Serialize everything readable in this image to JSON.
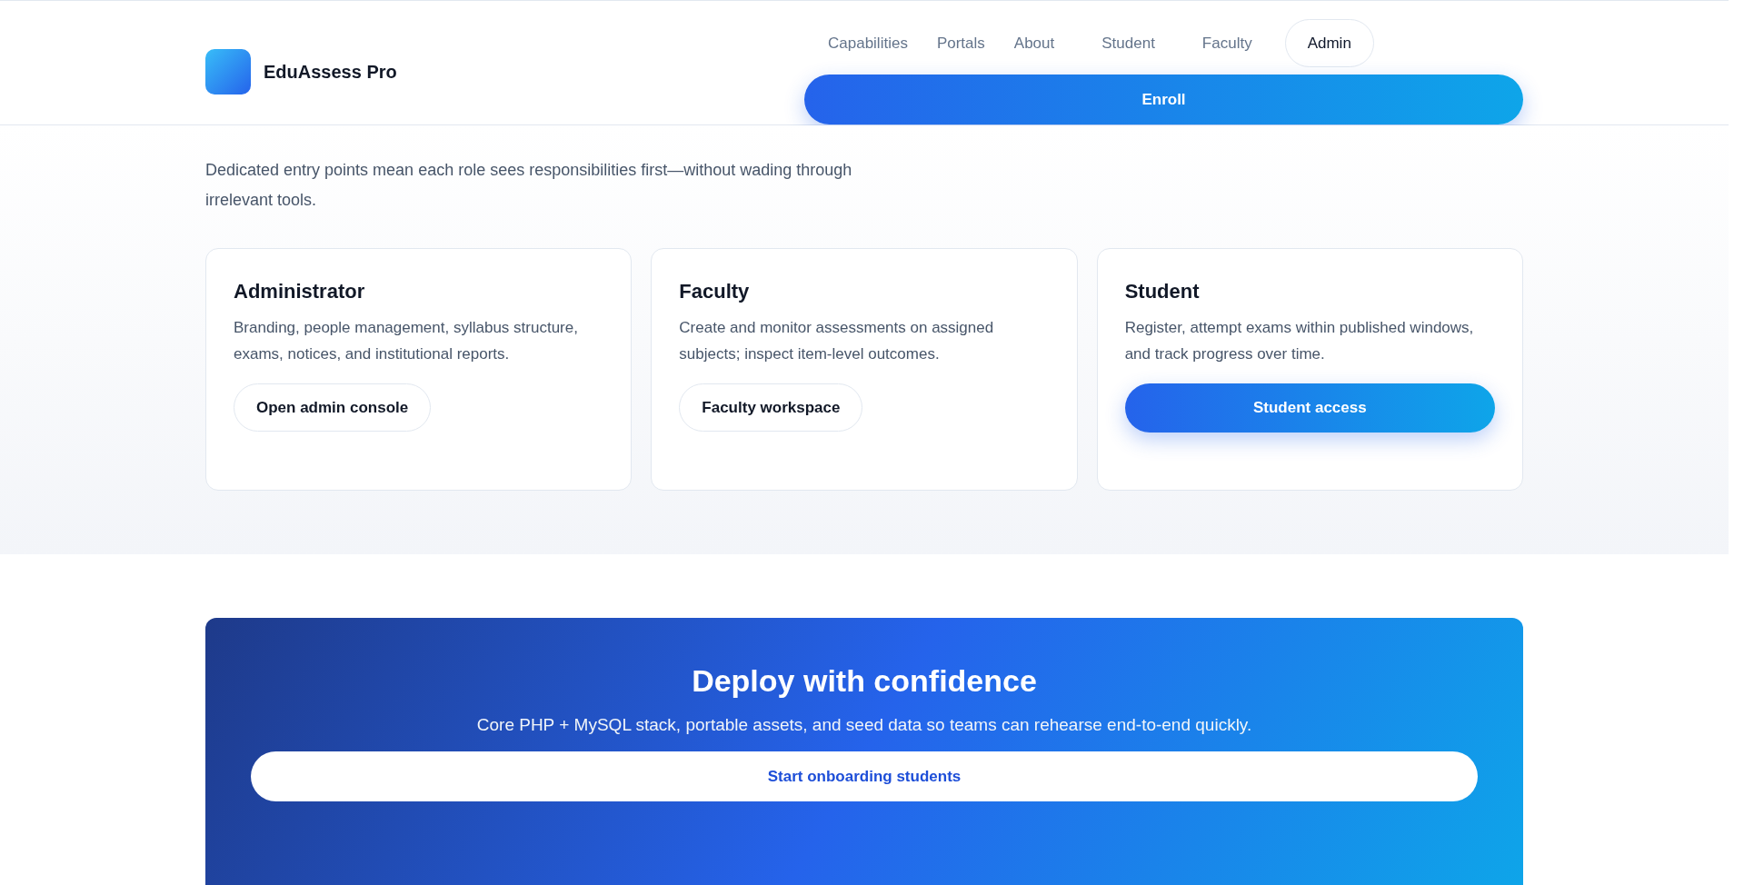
{
  "header": {
    "brand": "EduAssess Pro",
    "nav": [
      {
        "label": "Capabilities",
        "kind": "link"
      },
      {
        "label": "Portals",
        "kind": "link"
      },
      {
        "label": "About",
        "kind": "link"
      },
      {
        "label": "Student",
        "kind": "link"
      },
      {
        "label": "Faculty",
        "kind": "link"
      },
      {
        "label": "Admin",
        "kind": "pill"
      }
    ],
    "cta": "Enroll"
  },
  "portals": {
    "intro": "Dedicated entry points mean each role sees responsibilities first—without wading through irrelevant tools.",
    "cards": [
      {
        "title": "Administrator",
        "text": "Branding, people management, syllabus structure, exams, notices, and institutional reports.",
        "button": {
          "label": "Open admin console",
          "kind": "outline"
        }
      },
      {
        "title": "Faculty",
        "text": "Create and monitor assessments on assigned subjects; inspect item-level outcomes.",
        "button": {
          "label": "Faculty workspace",
          "kind": "outline"
        }
      },
      {
        "title": "Student",
        "text": "Register, attempt exams within published windows, and track progress over time.",
        "button": {
          "label": "Student access",
          "kind": "primary"
        }
      }
    ]
  },
  "banner": {
    "title": "Deploy with confidence",
    "text": "Core PHP + MySQL stack, portable assets, and seed data so teams can rehearse end-to-end quickly.",
    "button": "Start onboarding students"
  }
}
